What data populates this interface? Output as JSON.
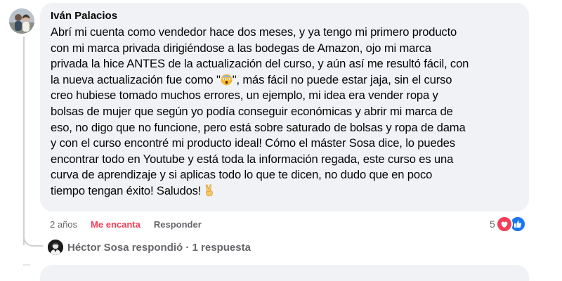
{
  "comment": {
    "author": "Iván Palacios",
    "lines": [
      "Abrí mi cuenta como vendedor hace dos meses, y ya tengo mi primero producto",
      "con mi marca privada dirigiéndose a las bodegas de Amazon, ojo mi marca",
      "privada la hice ANTES de la actualización del curso, y aún así me resultó fácil, con",
      "la nueva actualización fue como \"",
      "\", más fácil no puede estar jaja, sin el curso",
      "creo hubiese tomado muchos errores, un ejemplo, mi idea era vender ropa y",
      "bolsas de mujer que según yo podía conseguir económicas y abrir mi marca de",
      "eso, no digo que no funcione, pero está sobre saturado de bolsas y ropa de dama",
      "y con el curso encontré mi producto ideal! Cómo el máster Sosa dice, lo puedes",
      "encontrar todo en Youtube y está toda la información regada, este curso es una",
      "curva de aprendizaje y si aplicas todo lo que te dicen, no dudo que en poco",
      "tiempo tengan éxito! Saludos!"
    ],
    "emoji_inline": "face-screaming-icon",
    "emoji_end": "victory-hand-icon"
  },
  "actions": {
    "timestamp": "2 años",
    "love": "Me encanta",
    "reply": "Responder"
  },
  "reactions": {
    "count": "5",
    "icons": [
      "love-reaction-icon",
      "like-reaction-icon"
    ]
  },
  "reply_summary": {
    "text": "Héctor Sosa respondió · 1 respuesta"
  },
  "colors": {
    "bubble": "#f0f2f5",
    "text": "#050505",
    "secondary": "#65676b",
    "love": "#f33e58",
    "like": "#1877f2"
  }
}
